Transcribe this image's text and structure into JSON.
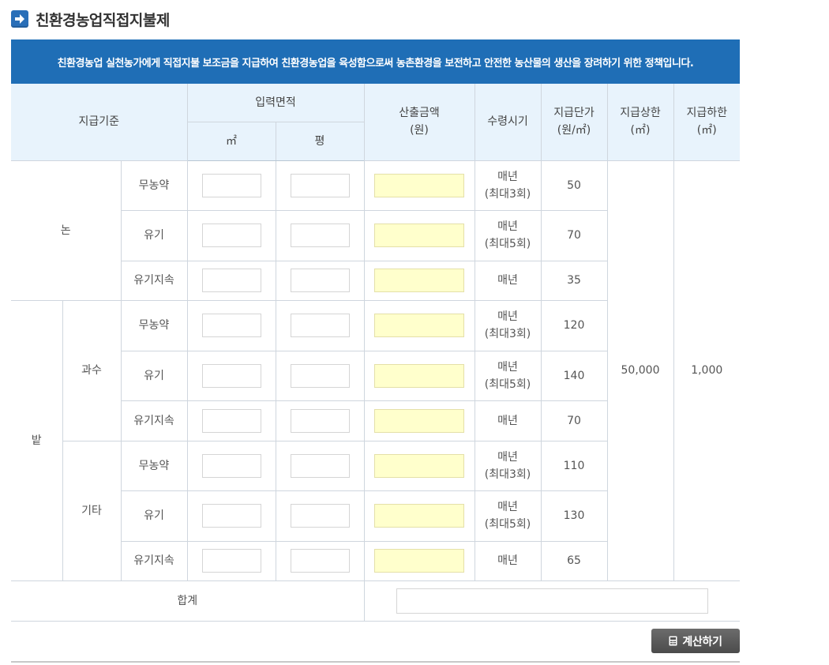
{
  "page_title": "친환경농업직접지불제",
  "banner_text": "친환경농업 실천농가에게 직접지불 보조금을 지급하여 친환경농업을 육성함으로써 농촌환경을 보전하고 안전한 농산물의 생산을 장려하기 위한 정책입니다.",
  "header": {
    "criteria": "지급기준",
    "input_area": "입력면적",
    "sqm": "㎡",
    "pyeong": "평",
    "amount": "산출금액\n(원)",
    "receipt_period": "수령시기",
    "unit_price": "지급단가\n(원/㎡)",
    "upper_limit": "지급상한\n(㎡)",
    "lower_limit": "지급하한\n(㎡)"
  },
  "groups": {
    "paddy": "논",
    "field": "밭",
    "orchard": "과수",
    "other": "기타"
  },
  "rows": [
    {
      "type": "무농약",
      "period": "매년\n(최대3회)",
      "unit_price": "50"
    },
    {
      "type": "유기",
      "period": "매년\n(최대5회)",
      "unit_price": "70"
    },
    {
      "type": "유기지속",
      "period": "매년",
      "unit_price": "35"
    },
    {
      "type": "무농약",
      "period": "매년\n(최대3회)",
      "unit_price": "120"
    },
    {
      "type": "유기",
      "period": "매년\n(최대5회)",
      "unit_price": "140"
    },
    {
      "type": "유기지속",
      "period": "매년",
      "unit_price": "70"
    },
    {
      "type": "무농약",
      "period": "매년\n(최대3회)",
      "unit_price": "110"
    },
    {
      "type": "유기",
      "period": "매년\n(최대5회)",
      "unit_price": "130"
    },
    {
      "type": "유기지속",
      "period": "매년",
      "unit_price": "65"
    }
  ],
  "upper_limit_value": "50,000",
  "lower_limit_value": "1,000",
  "total_label": "합계",
  "calc_button": "계산하기",
  "colors": {
    "banner": "#1f6eb6",
    "header_bg": "#e8f3fc",
    "amount_field": "#ffffcc",
    "lower_limit_text": "#cc5200",
    "button": "#555555"
  }
}
